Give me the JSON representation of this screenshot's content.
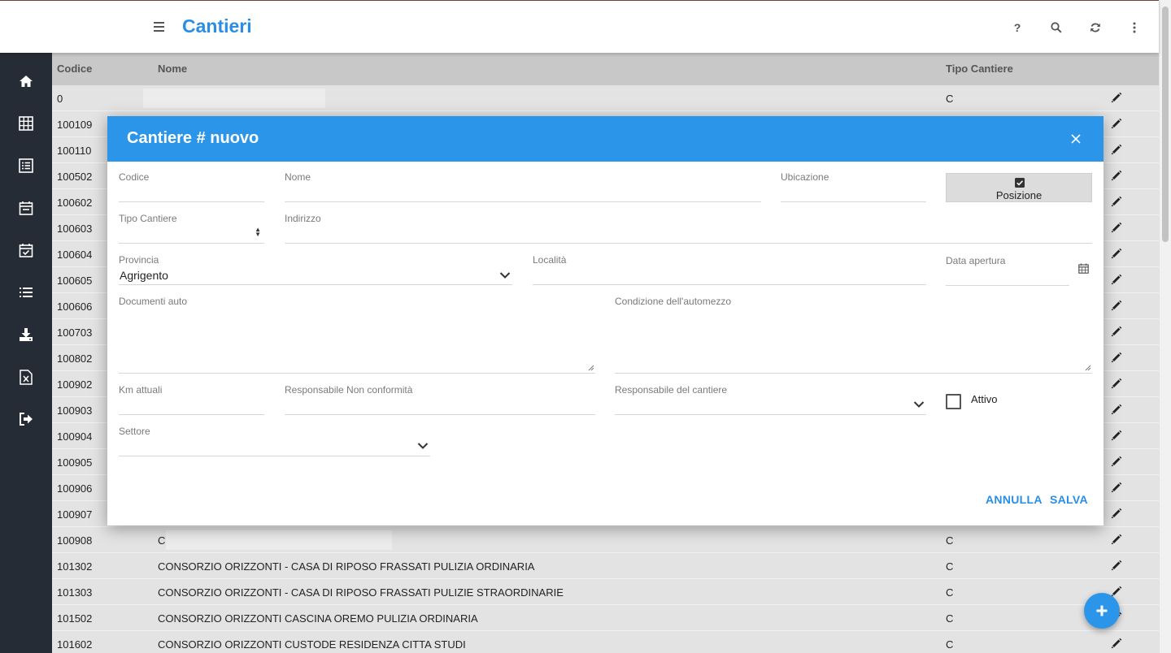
{
  "header": {
    "title": "Cantieri",
    "help_label": "?"
  },
  "table": {
    "columns": [
      "Codice",
      "Nome",
      "Tipo Cantiere"
    ],
    "rows": [
      {
        "codice": "0",
        "nome": "",
        "tipo": "C"
      },
      {
        "codice": "100109",
        "nome": "",
        "tipo": ""
      },
      {
        "codice": "100110",
        "nome": "",
        "tipo": ""
      },
      {
        "codice": "100502",
        "nome": "",
        "tipo": ""
      },
      {
        "codice": "100602",
        "nome": "",
        "tipo": ""
      },
      {
        "codice": "100603",
        "nome": "",
        "tipo": ""
      },
      {
        "codice": "100604",
        "nome": "",
        "tipo": ""
      },
      {
        "codice": "100605",
        "nome": "",
        "tipo": ""
      },
      {
        "codice": "100606",
        "nome": "",
        "tipo": ""
      },
      {
        "codice": "100703",
        "nome": "",
        "tipo": ""
      },
      {
        "codice": "100802",
        "nome": "",
        "tipo": ""
      },
      {
        "codice": "100902",
        "nome": "",
        "tipo": ""
      },
      {
        "codice": "100903",
        "nome": "",
        "tipo": ""
      },
      {
        "codice": "100904",
        "nome": "",
        "tipo": ""
      },
      {
        "codice": "100905",
        "nome": "",
        "tipo": ""
      },
      {
        "codice": "100906",
        "nome": "",
        "tipo": ""
      },
      {
        "codice": "100907",
        "nome": "",
        "tipo": ""
      },
      {
        "codice": "100908",
        "nome": "C",
        "tipo": "C"
      },
      {
        "codice": "101302",
        "nome": "CONSORZIO ORIZZONTI - CASA DI RIPOSO FRASSATI PULIZIA ORDINARIA",
        "tipo": "C"
      },
      {
        "codice": "101303",
        "nome": "CONSORZIO ORIZZONTI - CASA DI RIPOSO FRASSATI PULIZIE STRAORDINARIE",
        "tipo": "C"
      },
      {
        "codice": "101502",
        "nome": "CONSORZIO ORIZZONTI CASCINA OREMO PULIZIA ORDINARIA",
        "tipo": "C"
      },
      {
        "codice": "101602",
        "nome": "CONSORZIO ORIZZONTI CUSTODE RESIDENZA CITTA STUDI",
        "tipo": "C"
      }
    ]
  },
  "dialog": {
    "title": "Cantiere # nuovo",
    "fields": {
      "codice": {
        "label": "Codice",
        "value": ""
      },
      "nome": {
        "label": "Nome",
        "value": ""
      },
      "ubicazione": {
        "label": "Ubicazione",
        "value": ""
      },
      "tipo_cantiere": {
        "label": "Tipo Cantiere",
        "value": ""
      },
      "indirizzo": {
        "label": "Indirizzo",
        "value": ""
      },
      "provincia": {
        "label": "Provincia",
        "value": "Agrigento"
      },
      "localita": {
        "label": "Località",
        "value": ""
      },
      "data_apertura": {
        "label": "Data apertura",
        "value": ""
      },
      "documenti_auto": {
        "label": "Documenti auto",
        "value": ""
      },
      "condizione_automezzo": {
        "label": "Condizione dell'automezzo",
        "value": ""
      },
      "km_attuali": {
        "label": "Km attuali",
        "value": ""
      },
      "resp_non_conformita": {
        "label": "Responsabile Non conformità",
        "value": ""
      },
      "resp_cantiere": {
        "label": "Responsabile del cantiere",
        "value": ""
      },
      "settore": {
        "label": "Settore",
        "value": ""
      }
    },
    "posizione_label": "Posizione",
    "attivo_label": "Attivo",
    "annulla_label": "ANNULLA",
    "salva_label": "SALVA"
  },
  "colors": {
    "primary": "#2b95e9",
    "sidebar": "#262c36",
    "table_header": "#c8c8c8"
  }
}
